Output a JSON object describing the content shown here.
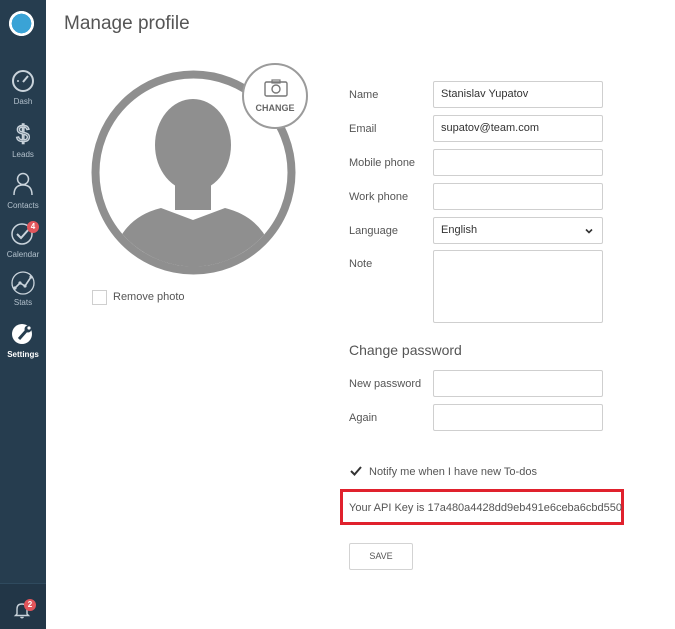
{
  "sidebar": {
    "items": [
      {
        "label": "Dash",
        "icon": "gauge-icon"
      },
      {
        "label": "Leads",
        "icon": "dollar-icon"
      },
      {
        "label": "Contacts",
        "icon": "person-icon"
      },
      {
        "label": "Calendar",
        "icon": "check-circle-icon",
        "badge": "4"
      },
      {
        "label": "Stats",
        "icon": "stats-icon"
      },
      {
        "label": "Settings",
        "icon": "wrench-icon",
        "active": true
      }
    ],
    "notifications_badge": "2"
  },
  "page": {
    "title": "Manage profile"
  },
  "photo": {
    "change_label": "CHANGE",
    "remove_label": "Remove photo"
  },
  "form": {
    "name": {
      "label": "Name",
      "value": "Stanislav Yupatov"
    },
    "email": {
      "label": "Email",
      "value": "supatov@team.com"
    },
    "mobile_phone": {
      "label": "Mobile phone",
      "value": ""
    },
    "work_phone": {
      "label": "Work phone",
      "value": ""
    },
    "language": {
      "label": "Language",
      "value": "English"
    },
    "note": {
      "label": "Note",
      "value": ""
    }
  },
  "password": {
    "section_title": "Change password",
    "new_password": {
      "label": "New password",
      "value": ""
    },
    "again": {
      "label": "Again",
      "value": ""
    }
  },
  "notify": {
    "label": "Notify me when I have new To-dos",
    "checked": true
  },
  "api": {
    "text": "Your API Key is 17a480a4428dd9eb491e6ceba6cbd550"
  },
  "actions": {
    "save_label": "SAVE"
  },
  "colors": {
    "sidebar": "#263d4f",
    "highlight": "#e0212d",
    "badge": "#e2555b"
  }
}
